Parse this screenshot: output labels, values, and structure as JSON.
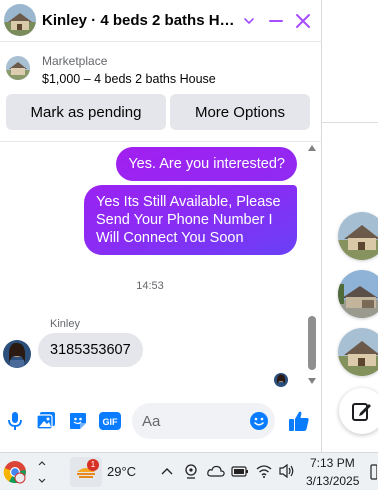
{
  "chat": {
    "title": "Kinley · 4 beds 2 baths Ho…",
    "header_controls": [
      "chevron-down-icon",
      "minimize-icon",
      "close-icon"
    ],
    "listing": {
      "source": "Marketplace",
      "description": "$1,000 – 4 beds 2 baths House",
      "actions": [
        "Mark as pending",
        "More Options"
      ]
    },
    "messages": [
      {
        "direction": "out",
        "text": "Yes. Are you interested?"
      },
      {
        "direction": "out",
        "text": "Yes Its Still Available, Please Send Your Phone Number I Will Connect You Soon"
      },
      {
        "timestamp": "14:53"
      },
      {
        "direction": "in",
        "sender": "Kinley",
        "text": "3185353607"
      }
    ],
    "composer": {
      "placeholder": "Aa",
      "icons": [
        "microphone-icon",
        "photo-icon",
        "sticker-icon",
        "gif-icon",
        "emoji-icon",
        "like-icon"
      ],
      "gif_label": "GIF"
    }
  },
  "side_chat_heads": [
    "house-thumbnail",
    "house-thumbnail",
    "house-thumbnail"
  ],
  "taskbar": {
    "weather": {
      "temperature": "29°C",
      "badge": "1"
    },
    "clock": {
      "time": "7:13 PM",
      "date": "3/13/2025"
    }
  },
  "colors": {
    "accent": "#8a2cf4",
    "incoming_bubble": "#e4e6eb",
    "icon_blue": "#0a7cff",
    "header_icon": "#a64dff"
  }
}
